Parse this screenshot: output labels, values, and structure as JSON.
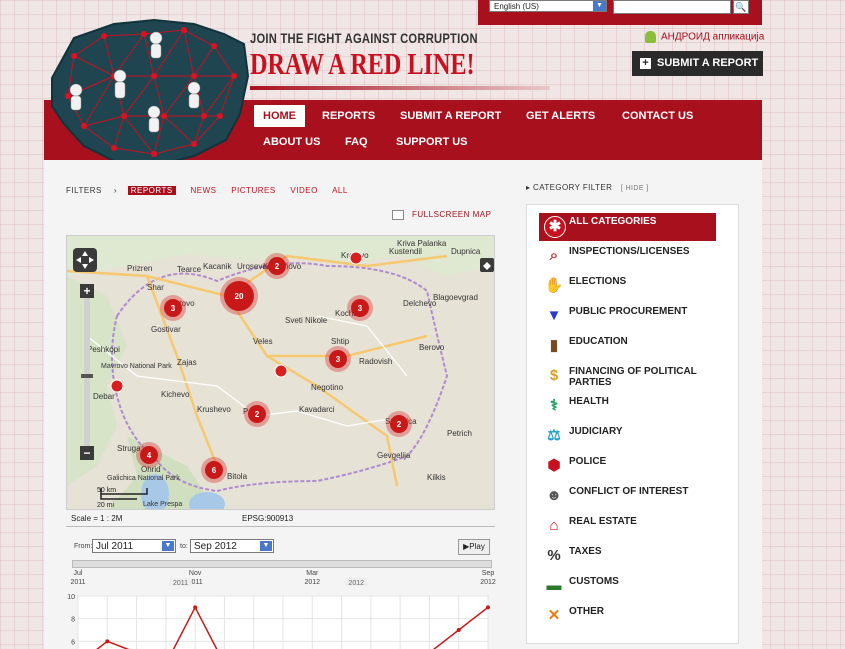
{
  "top": {
    "language": "English (US)",
    "search_placeholder": "",
    "android_link": "АНДРОИД апликација",
    "submit_report": "SUBMIT A REPORT"
  },
  "header": {
    "tagline": "JOIN THE FIGHT AGAINST CORRUPTION",
    "headline": "DRAW A RED LINE!"
  },
  "nav": {
    "row1": [
      "HOME",
      "REPORTS",
      "SUBMIT A REPORT",
      "GET ALERTS",
      "CONTACT US"
    ],
    "row2": [
      "ABOUT US",
      "FAQ",
      "SUPPORT US"
    ]
  },
  "filters": {
    "label": "FILTERS",
    "items": [
      "REPORTS",
      "NEWS",
      "PICTURES",
      "VIDEO",
      "ALL"
    ]
  },
  "fullscreen_map": "FULLSCREEN MAP",
  "map": {
    "places": [
      "Prizren",
      "Tetovo",
      "Gostivar",
      "Kumanovo",
      "Kratovo",
      "Kriva Palanka",
      "Kustendil",
      "Dupnica",
      "Blagoevgrad",
      "Delchevo",
      "Kochani",
      "Shtip",
      "Sveti Nikole",
      "Veles",
      "Radovish",
      "Berovo",
      "Strumica",
      "Negotino",
      "Kavadarci",
      "Prilep",
      "Krushevo",
      "Kichevo",
      "Debar",
      "Peshkopi",
      "Struga",
      "Ohrid",
      "Bitola",
      "Gevgelija",
      "Kilkis",
      "Galichica National Park",
      "Mavrovo National Park",
      "Lake Prespa",
      "Zajas",
      "Tearce",
      "Kacanik",
      "Urosevac",
      "Petrich",
      "Shar"
    ],
    "clusters": [
      "2",
      "20",
      "3",
      "3",
      "3",
      "2",
      "2",
      "4",
      "6"
    ],
    "scale_bar_top": "50 km",
    "scale_bar_bottom": "20 mi",
    "scale": "Scale = 1 : 2M",
    "projection": "EPSG:900913"
  },
  "timeline": {
    "from_label": "From:",
    "to_label": "to:",
    "from_value": "Jul 2011",
    "to_value": "Sep 2012",
    "play": "Play"
  },
  "chart_data": {
    "type": "line",
    "x_ticks": [
      "Jul 2011",
      "Nov 2011",
      "Mar 2012",
      "Sep 2012"
    ],
    "year_labels": [
      "2011",
      "2012"
    ],
    "yticks": [
      6,
      8,
      10
    ],
    "ylim": [
      4,
      10
    ],
    "series": [
      {
        "x": [
          "Jul 2011",
          "Aug 2011",
          "Sep 2011",
          "Oct 2011",
          "Nov 2011",
          "Dec 2011",
          "Jan 2012",
          "Feb 2012",
          "Mar 2012",
          "Apr 2012",
          "May 2012",
          "Jun 2012",
          "Jul 2012",
          "Aug 2012",
          "Sep 2012"
        ],
        "values": [
          4,
          6,
          5,
          4,
          9,
          4,
          3,
          3,
          4,
          4,
          3,
          3,
          5,
          7,
          9
        ]
      }
    ],
    "grid": true
  },
  "categories": {
    "header": "CATEGORY FILTER",
    "hide": "[ HIDE ]",
    "items": [
      {
        "label": "ALL CATEGORIES",
        "icon": "all-categories-icon",
        "color": "#c8101e"
      },
      {
        "label": "INSPECTIONS/LICENSES",
        "icon": "magnifier-icon",
        "color": "#c84040"
      },
      {
        "label": "ELECTIONS",
        "icon": "ballot-hand-icon",
        "color": "#7a3ab0"
      },
      {
        "label": "PUBLIC PROCUREMENT",
        "icon": "cup-icon",
        "color": "#2a3acf"
      },
      {
        "label": "EDUCATION",
        "icon": "book-icon",
        "color": "#7a4a20"
      },
      {
        "label": "FINANCING OF POLITICAL PARTIES",
        "icon": "dollar-icon",
        "color": "#d4a020"
      },
      {
        "label": "HEALTH",
        "icon": "caduceus-icon",
        "color": "#20a060"
      },
      {
        "label": "JUDICIARY",
        "icon": "gavel-icon",
        "color": "#20a0d0"
      },
      {
        "label": "POLICE",
        "icon": "stop-sign-icon",
        "color": "#c8101e"
      },
      {
        "label": "CONFLICT OF INTEREST",
        "icon": "faces-icon",
        "color": "#555555"
      },
      {
        "label": "REAL ESTATE",
        "icon": "house-icon",
        "color": "#c8101e"
      },
      {
        "label": "TAXES",
        "icon": "percent-icon",
        "color": "#333333"
      },
      {
        "label": "CUSTOMS",
        "icon": "truck-icon",
        "color": "#2a7a2a"
      },
      {
        "label": "OTHER",
        "icon": "other-circle-icon",
        "color": "#e87a10"
      }
    ]
  }
}
